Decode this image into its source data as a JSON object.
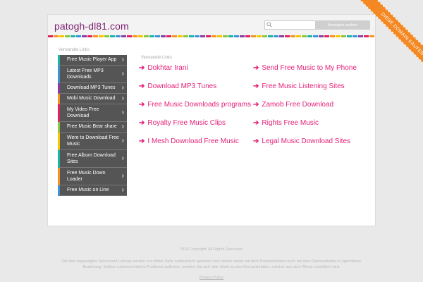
{
  "header": {
    "domain": "patogh-dl81.com",
    "search_placeholder": "",
    "search_button": "Anzeigen suchen"
  },
  "ribbon": {
    "label": "DIESE DOMAIN KAUFEN."
  },
  "sidebar": {
    "heading": "Verwandte Links",
    "items": [
      {
        "label": "Free Music Player App",
        "color": "#1bb5a6"
      },
      {
        "label": "Latest Free MP3 Downloads",
        "color": "#3d94d9"
      },
      {
        "label": "Download MP3 Tunes",
        "color": "#8a3ea4"
      },
      {
        "label": "Mobi Music Download",
        "color": "#f7931e"
      },
      {
        "label": "My Video Free Download",
        "color": "#e3225e"
      },
      {
        "label": "Free Music Bear share",
        "color": "#8cc63f"
      },
      {
        "label": "Were to Download Free Music",
        "color": "#f6c600"
      },
      {
        "label": "Free Album Download Sites",
        "color": "#1bb5a6"
      },
      {
        "label": "Free Music Down Loader",
        "color": "#f7931e"
      },
      {
        "label": "Free Music on Line",
        "color": "#3d94d9"
      }
    ]
  },
  "content": {
    "heading": "Verwandte Links",
    "left_links": [
      "Dokhtar Irani",
      "Download MP3 Tunes",
      "Free Music Downloads programs",
      "Royalty Free Music Clips",
      "I Mesh Download Free Music"
    ],
    "right_links": [
      "Send Free Music to My Phone",
      "Free Music Listening Sites",
      "Zamob Free Download",
      "Rights Free Music",
      "Legal Music Download Sites"
    ],
    "arrow": "➔"
  },
  "footer": {
    "copyright": "2018 Copyright. All Rights Reserved.",
    "disclaimer_line1": "Die hier angezeigten Sponsored Listings werden von dritter Seite automatisch generiert und stehen weder mit dem Domaininhaber noch mit dem Dienstanbieter in irgendeiner",
    "disclaimer_line2": "Beziehung. Sollten markenrechtliche Probleme auftreten, wenden Sie sich bitte direkt an den Domaininhaber, welcher aus dem Whois ersichtlich wird.",
    "privacy": "Privacy Policy"
  }
}
